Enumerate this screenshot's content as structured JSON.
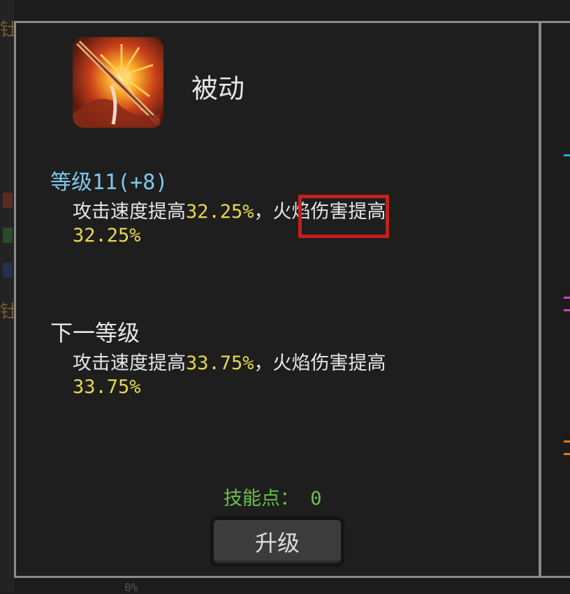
{
  "background": {
    "left_glyph_top": "钍",
    "left_glyph_mid": "钍",
    "bottom_text": "0%"
  },
  "skill": {
    "icon": "fire-spear-icon",
    "name": "被动",
    "level_text": "等级11(+8)",
    "current": {
      "prefix": "攻击速度提高",
      "value1": "32.25%",
      "middle": "，火焰伤害提高",
      "value2": "32.25%"
    }
  },
  "next_level": {
    "title": "下一等级",
    "prefix": "攻击速度提高",
    "value1": "33.75%",
    "middle": "，火焰伤害提高",
    "value2": "33.75%"
  },
  "skill_points": {
    "text": "技能点： 0"
  },
  "upgrade_button": {
    "label": "升级"
  },
  "colors": {
    "level_blue": "#7fc8f0",
    "value_yellow": "#e8d84a",
    "points_green": "#6cc04a",
    "highlight_red": "#c4201c"
  }
}
